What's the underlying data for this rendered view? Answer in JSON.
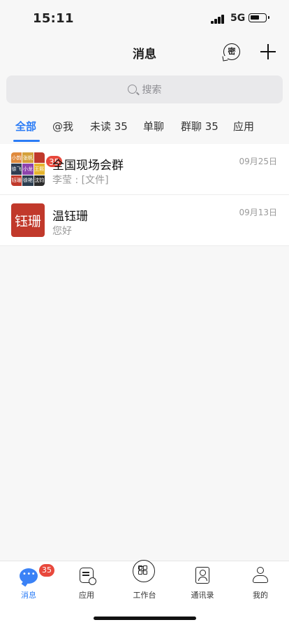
{
  "status_bar": {
    "time": "15:11",
    "network": "5G",
    "battery_fill": 0.55
  },
  "header": {
    "title": "消息",
    "secret_label": "密"
  },
  "search": {
    "placeholder": "搜索"
  },
  "filter_tabs": [
    {
      "label": "全部",
      "active": true
    },
    {
      "label": "@我"
    },
    {
      "label": "未读 35"
    },
    {
      "label": "单聊"
    },
    {
      "label": "群聊 35"
    },
    {
      "label": "应用"
    }
  ],
  "conversations": [
    {
      "name": "全国现场会群",
      "preview": "李莹 : [文件]",
      "date": "09月25日",
      "badge": "35",
      "avatar_tiles": [
        {
          "text": "小韵",
          "color": "#e08a3c"
        },
        {
          "text": "张帆",
          "color": "#d4a03a"
        },
        {
          "text": "",
          "color": "#c0392b"
        },
        {
          "text": "徐飞",
          "color": "#2f3d52"
        },
        {
          "text": "小龙",
          "color": "#8e44ad"
        },
        {
          "text": "王熙",
          "color": "#e6b52e"
        },
        {
          "text": "钰珊",
          "color": "#c0392b"
        },
        {
          "text": "徐艳",
          "color": "#2c3e50"
        },
        {
          "text": "沈钧",
          "color": "#2c2c2c"
        }
      ]
    },
    {
      "name": "温钰珊",
      "preview": "您好",
      "date": "09月13日",
      "avatar_text": "钰珊",
      "avatar_color": "#c1392b"
    }
  ],
  "tabbar": {
    "items": [
      {
        "label": "消息",
        "icon": "chat-icon",
        "active": true,
        "badge": "35"
      },
      {
        "label": "应用",
        "icon": "app-icon"
      },
      {
        "label": "工作台",
        "icon": "grid-icon"
      },
      {
        "label": "通讯录",
        "icon": "contacts-icon"
      },
      {
        "label": "我的",
        "icon": "person-icon"
      }
    ]
  }
}
